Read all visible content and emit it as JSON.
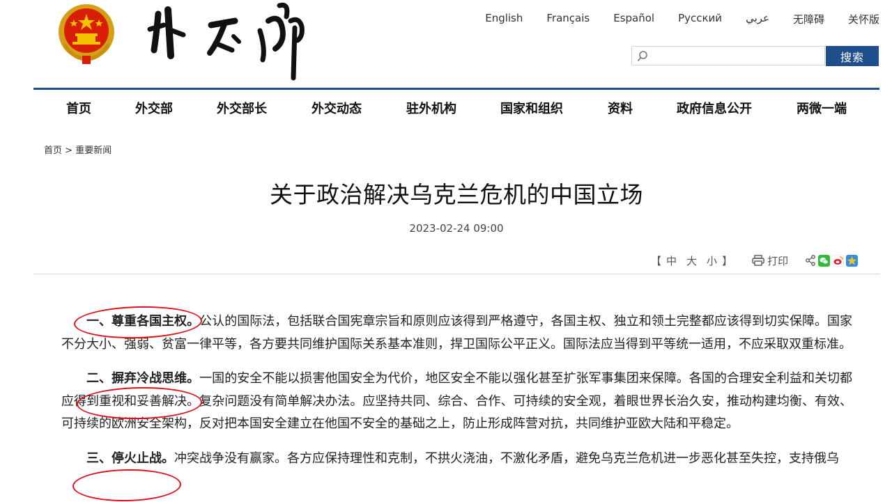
{
  "header": {
    "languages": [
      "English",
      "Français",
      "Español",
      "Русский",
      "عربي",
      "无障碍",
      "关怀版"
    ],
    "search": {
      "placeholder": "",
      "button_label": "搜索"
    }
  },
  "nav": {
    "items": [
      "首页",
      "外交部",
      "外交部长",
      "外交动态",
      "驻外机构",
      "国家和组织",
      "资料",
      "政府信息公开",
      "两微一端"
    ]
  },
  "breadcrumb": {
    "home": "首页",
    "separator": ">",
    "current": "重要新闻"
  },
  "article": {
    "title": "关于政治解决乌克兰危机的中国立场",
    "date": "2023-02-24 09:00",
    "font_size_controls": {
      "open": "【",
      "large": "中",
      "medium": "大",
      "small": "小",
      "close": "】"
    },
    "print_label": "打印",
    "sections": [
      {
        "heading": "一、尊重各国主权。",
        "body": "公认的国际法，包括联合国宪章宗旨和原则应该得到严格遵守，各国主权、独立和领土完整都应该得到切实保障。国家不分大小、强弱、贫富一律平等，各方要共同维护国际关系基本准则，捍卫国际公平正义。国际法应当得到平等统一适用，不应采取双重标准。"
      },
      {
        "heading": "二、摒弃冷战思维。",
        "body": "一国的安全不能以损害他国安全为代价，地区安全不能以强化甚至扩张军事集团来保障。各国的合理安全利益和关切都应得到重视和妥善解决。复杂问题没有简单解决办法。应坚持共同、综合、合作、可持续的安全观，着眼世界长治久安，推动构建均衡、有效、可持续的欧洲安全架构，反对把本国安全建立在他国不安全的基础之上，防止形成阵营对抗，共同维护亚欧大陆和平稳定。"
      },
      {
        "heading": "三、停火止战。",
        "body": "冲突战争没有赢家。各方应保持理性和克制，不拱火浇油，不激化矛盾，避免乌克兰危机进一步恶化甚至失控，支持俄乌"
      }
    ]
  },
  "colors": {
    "brand_blue": "#1f4e8c",
    "annotation_red": "#e0101a"
  }
}
